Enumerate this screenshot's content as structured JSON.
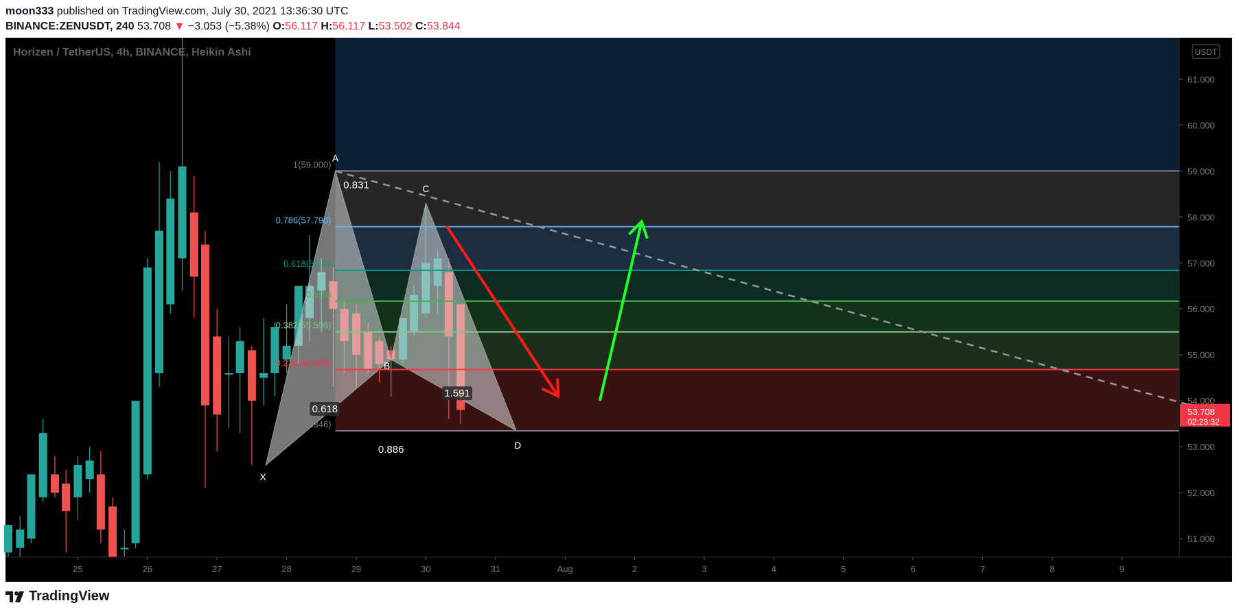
{
  "header": {
    "author": "moon333",
    "published": "published on TradingView.com, July 30, 2021 13:36:30 UTC",
    "symbol": "BINANCE:ZENUSDT, 240",
    "last": "53.708",
    "arrow": "▼",
    "change": "−3.053 (−5.38%)",
    "o_label": "O:",
    "o": "56.117",
    "h_label": "H:",
    "h": "56.117",
    "l_label": "L:",
    "l": "53.502",
    "c_label": "C:",
    "c": "53.844"
  },
  "chart_title": "Horizen / TetherUS, 4h, BINANCE, Heikin Ashi",
  "currency_badge": "USDT",
  "price_label": {
    "value": "53.708",
    "countdown": "02:23:32"
  },
  "footer": {
    "brand": "TradingView"
  },
  "colors": {
    "up": "#26a69a",
    "down": "#ef5350",
    "background": "#000000",
    "fib_1": "#787b86",
    "fib_786": "#64b5f6",
    "fib_618": "#089981",
    "fib_05": "#4caf50",
    "fib_382": "#81c784",
    "fib_236": "#f23645",
    "arrow_down": "#ff1a1a",
    "arrow_up": "#22ff22"
  },
  "chart_data": {
    "type": "candlestick",
    "style": "Heikin Ashi",
    "ylim": [
      50.6,
      61.9
    ],
    "y_ticks": [
      "61.000",
      "60.000",
      "59.000",
      "58.000",
      "57.000",
      "56.000",
      "55.000",
      "54.000",
      "53.000",
      "52.000",
      "51.000"
    ],
    "x_ticks": [
      "25",
      "26",
      "27",
      "28",
      "29",
      "30",
      "31",
      "Aug",
      "2",
      "3",
      "4",
      "5",
      "6",
      "7",
      "8",
      "9"
    ],
    "candles": [
      {
        "t": 24.0,
        "o": 50.7,
        "h": 51.3,
        "l": 50.6,
        "c": 51.3
      },
      {
        "t": 24.17,
        "o": 50.8,
        "h": 51.5,
        "l": 50.6,
        "c": 51.2
      },
      {
        "t": 24.33,
        "o": 51.0,
        "h": 52.3,
        "l": 50.9,
        "c": 52.4
      },
      {
        "t": 24.5,
        "o": 51.9,
        "h": 53.6,
        "l": 51.8,
        "c": 53.3
      },
      {
        "t": 24.67,
        "o": 52.4,
        "h": 52.8,
        "l": 51.9,
        "c": 52.0
      },
      {
        "t": 24.83,
        "o": 52.2,
        "h": 52.5,
        "l": 50.7,
        "c": 51.6
      },
      {
        "t": 25.0,
        "o": 51.9,
        "h": 52.8,
        "l": 51.4,
        "c": 52.6
      },
      {
        "t": 25.17,
        "o": 52.3,
        "h": 53.0,
        "l": 52.0,
        "c": 52.7
      },
      {
        "t": 25.33,
        "o": 52.4,
        "h": 52.9,
        "l": 50.9,
        "c": 51.2
      },
      {
        "t": 25.5,
        "o": 51.7,
        "h": 51.9,
        "l": 50.6,
        "c": 50.6
      },
      {
        "t": 25.67,
        "o": 50.8,
        "h": 51.2,
        "l": 50.6,
        "c": 50.8
      },
      {
        "t": 25.83,
        "o": 50.9,
        "h": 54.0,
        "l": 50.8,
        "c": 54.0
      },
      {
        "t": 26.0,
        "o": 52.4,
        "h": 57.1,
        "l": 52.3,
        "c": 56.9
      },
      {
        "t": 26.17,
        "o": 54.6,
        "h": 59.2,
        "l": 54.3,
        "c": 57.7
      },
      {
        "t": 26.33,
        "o": 56.1,
        "h": 59.0,
        "l": 55.9,
        "c": 58.4
      },
      {
        "t": 26.5,
        "o": 57.1,
        "h": 61.9,
        "l": 56.4,
        "c": 59.1
      },
      {
        "t": 26.67,
        "o": 58.1,
        "h": 58.9,
        "l": 55.8,
        "c": 56.7
      },
      {
        "t": 26.83,
        "o": 57.4,
        "h": 57.7,
        "l": 52.1,
        "c": 53.9
      },
      {
        "t": 27.0,
        "o": 55.4,
        "h": 56.0,
        "l": 52.9,
        "c": 53.7
      },
      {
        "t": 27.17,
        "o": 54.6,
        "h": 55.4,
        "l": 53.4,
        "c": 54.6
      },
      {
        "t": 27.33,
        "o": 54.6,
        "h": 55.6,
        "l": 53.3,
        "c": 55.3
      },
      {
        "t": 27.5,
        "o": 55.1,
        "h": 55.2,
        "l": 52.6,
        "c": 54.0
      },
      {
        "t": 27.67,
        "o": 54.5,
        "h": 55.8,
        "l": 53.9,
        "c": 54.6
      },
      {
        "t": 27.83,
        "o": 54.6,
        "h": 55.7,
        "l": 54.1,
        "c": 55.6
      },
      {
        "t": 28.0,
        "o": 54.9,
        "h": 56.1,
        "l": 54.6,
        "c": 55.2
      },
      {
        "t": 28.17,
        "o": 55.2,
        "h": 56.2,
        "l": 54.8,
        "c": 56.5
      },
      {
        "t": 28.33,
        "o": 55.8,
        "h": 57.6,
        "l": 55.3,
        "c": 56.5
      },
      {
        "t": 28.5,
        "o": 56.4,
        "h": 57.1,
        "l": 55.5,
        "c": 56.8
      },
      {
        "t": 28.67,
        "o": 56.6,
        "h": 56.9,
        "l": 54.3,
        "c": 56.0
      },
      {
        "t": 28.83,
        "o": 56.0,
        "h": 56.2,
        "l": 54.6,
        "c": 55.3
      },
      {
        "t": 29.0,
        "o": 55.9,
        "h": 56.1,
        "l": 54.3,
        "c": 55.0
      },
      {
        "t": 29.17,
        "o": 55.5,
        "h": 55.7,
        "l": 54.6,
        "c": 54.7
      },
      {
        "t": 29.33,
        "o": 55.3,
        "h": 55.4,
        "l": 54.4,
        "c": 54.8
      },
      {
        "t": 29.5,
        "o": 55.1,
        "h": 55.2,
        "l": 54.1,
        "c": 54.9
      },
      {
        "t": 29.67,
        "o": 54.9,
        "h": 55.8,
        "l": 54.8,
        "c": 55.8
      },
      {
        "t": 29.83,
        "o": 55.5,
        "h": 56.5,
        "l": 55.4,
        "c": 56.3
      },
      {
        "t": 30.0,
        "o": 55.9,
        "h": 58.3,
        "l": 55.8,
        "c": 57.0
      },
      {
        "t": 30.17,
        "o": 56.5,
        "h": 57.3,
        "l": 55.9,
        "c": 57.1
      },
      {
        "t": 30.33,
        "o": 56.8,
        "h": 57.1,
        "l": 53.6,
        "c": 55.4
      },
      {
        "t": 30.5,
        "o": 56.1,
        "h": 56.1,
        "l": 53.5,
        "c": 53.8
      }
    ],
    "fib_levels": [
      {
        "ratio": "1",
        "price": 59.0,
        "label": "1(59.000)"
      },
      {
        "ratio": "0.786",
        "price": 57.79,
        "label": "0.786(57.790)"
      },
      {
        "ratio": "0.618",
        "price": 56.84,
        "label": "0.618(56.84"
      },
      {
        "ratio": "0.5",
        "price": 56.17,
        "label": "0.5(56"
      },
      {
        "ratio": "0.382",
        "price": 55.5,
        "label": "0.382(55.506)"
      },
      {
        "ratio": "0.236",
        "price": 54.68,
        "label": "0.236(54.680)"
      },
      {
        "ratio": "0",
        "price": 53.346,
        "label": "0(53.346)"
      }
    ],
    "pattern_points": [
      {
        "name": "X",
        "t": 27.7,
        "price": 52.6
      },
      {
        "name": "A",
        "t": 28.7,
        "price": 59.0
      },
      {
        "name": "B",
        "t": 29.5,
        "price": 54.9
      },
      {
        "name": "C",
        "t": 30.0,
        "price": 58.3
      },
      {
        "name": "D",
        "t": 31.3,
        "price": 53.35
      }
    ],
    "pattern_ratios": [
      {
        "label": "0.831",
        "t": 29.0,
        "price": 58.65
      },
      {
        "label": "0.618",
        "t": 28.55,
        "price": 53.78
      },
      {
        "label": "1.591",
        "t": 30.45,
        "price": 54.12
      },
      {
        "label": "0.886",
        "t": 29.5,
        "price": 52.9
      }
    ],
    "trendline": {
      "t1": 28.7,
      "p1": 59.0,
      "t2": 41.0,
      "p2": 53.9
    },
    "arrow_down": {
      "t1": 30.3,
      "p1": 57.8,
      "t2": 31.9,
      "p2": 54.1
    },
    "arrow_up": {
      "t1": 32.5,
      "p1": 54.0,
      "t2": 33.1,
      "p2": 57.9
    },
    "fill_start_t": 28.7
  }
}
